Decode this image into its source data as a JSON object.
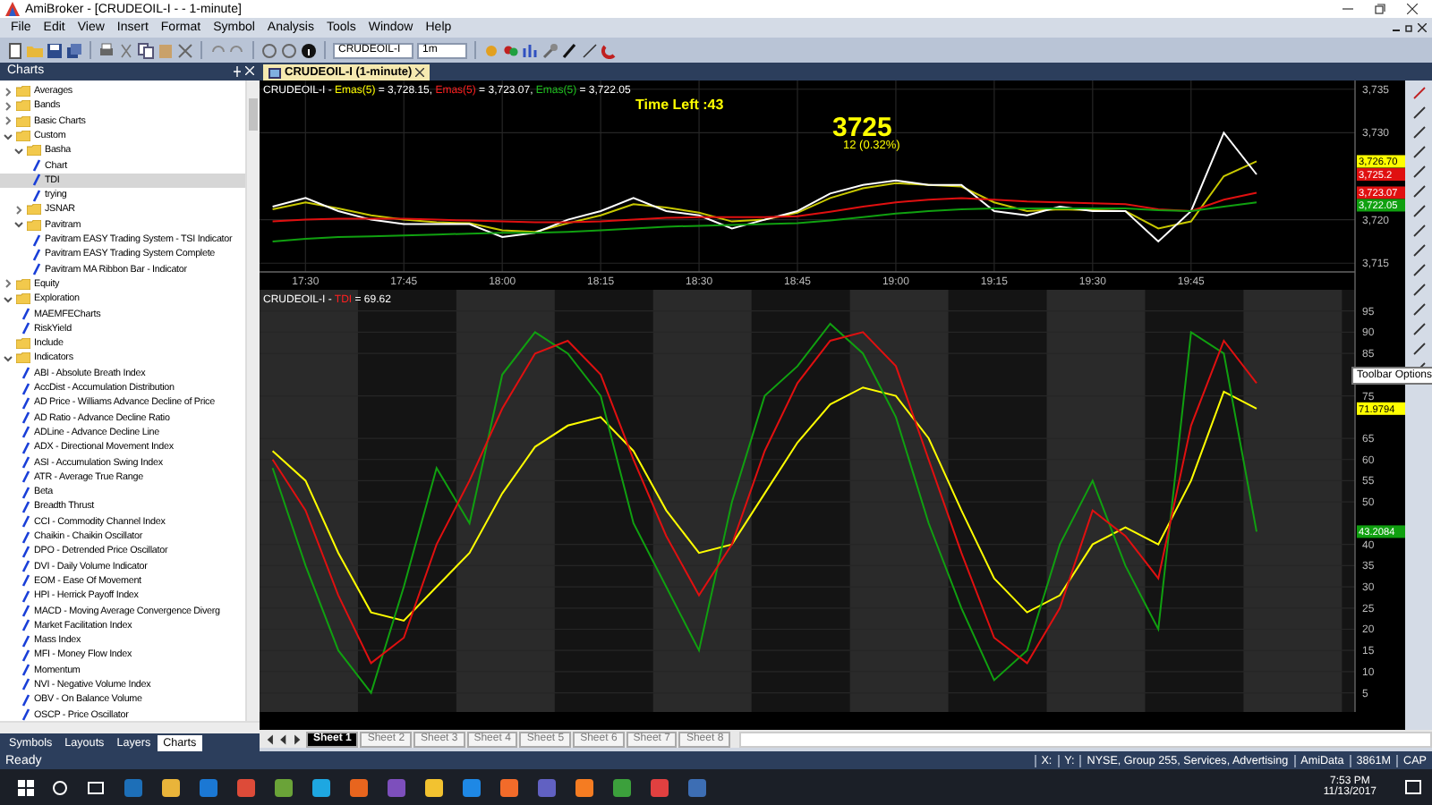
{
  "window": {
    "title": "AmiBroker - [CRUDEOIL-I -  - 1-minute]"
  },
  "menu": [
    "File",
    "Edit",
    "View",
    "Insert",
    "Format",
    "Symbol",
    "Analysis",
    "Tools",
    "Window",
    "Help"
  ],
  "toolbar": {
    "symbol": "CRUDEOIL-I",
    "interval": "1m"
  },
  "charts_panel": {
    "title": "Charts",
    "tree": [
      {
        "label": "Averages",
        "kind": "folder",
        "expanded": false,
        "selected": false
      },
      {
        "label": "Bands",
        "kind": "folder",
        "expanded": false,
        "selected": false
      },
      {
        "label": "Basic Charts",
        "kind": "folder",
        "expanded": false,
        "selected": false
      },
      {
        "label": "Custom",
        "kind": "folder",
        "expanded": true,
        "selected": false,
        "children": [
          {
            "label": "Basha",
            "kind": "folder",
            "expanded": true,
            "selected": false,
            "children": [
              {
                "label": "Chart",
                "kind": "formula",
                "selected": false
              },
              {
                "label": "TDI",
                "kind": "formula",
                "selected": true
              },
              {
                "label": "trying",
                "kind": "formula",
                "selected": false
              }
            ]
          },
          {
            "label": "JSNAR",
            "kind": "folder",
            "expanded": false,
            "selected": false
          },
          {
            "label": "Pavitram",
            "kind": "folder",
            "expanded": true,
            "selected": false,
            "children": [
              {
                "label": "Pavitram EASY Trading System - TSI Indicator",
                "kind": "formula",
                "selected": false
              },
              {
                "label": "Pavitram EASY Trading System Complete",
                "kind": "formula",
                "selected": false
              },
              {
                "label": "Pavitram MA Ribbon Bar - Indicator",
                "kind": "formula",
                "selected": false
              }
            ]
          }
        ]
      },
      {
        "label": "Equity",
        "kind": "folder",
        "expanded": false,
        "selected": false
      },
      {
        "label": "Exploration",
        "kind": "folder",
        "expanded": true,
        "selected": false,
        "children": [
          {
            "label": "MAEMFECharts",
            "kind": "formula",
            "selected": false
          },
          {
            "label": "RiskYield",
            "kind": "formula",
            "selected": false
          }
        ]
      },
      {
        "label": "Include",
        "kind": "folder",
        "selected": false
      },
      {
        "label": "Indicators",
        "kind": "folder",
        "expanded": true,
        "selected": false,
        "children": [
          {
            "label": "ABI - Absolute Breath Index",
            "kind": "formula",
            "selected": false
          },
          {
            "label": "AccDist - Accumulation Distribution",
            "kind": "formula",
            "selected": false
          },
          {
            "label": "AD Price - Williams Advance Decline of Price",
            "kind": "formula",
            "selected": false
          },
          {
            "label": "AD Ratio - Advance Decline Ratio",
            "kind": "formula",
            "selected": false
          },
          {
            "label": "ADLine - Advance Decline Line",
            "kind": "formula",
            "selected": false
          },
          {
            "label": "ADX - Directional Movement Index",
            "kind": "formula",
            "selected": false
          },
          {
            "label": "ASI - Accumulation Swing Index",
            "kind": "formula",
            "selected": false
          },
          {
            "label": "ATR - Average True Range",
            "kind": "formula",
            "selected": false
          },
          {
            "label": "Beta",
            "kind": "formula",
            "selected": false
          },
          {
            "label": "Breadth Thrust",
            "kind": "formula",
            "selected": false
          },
          {
            "label": "CCI - Commodity Channel Index",
            "kind": "formula",
            "selected": false
          },
          {
            "label": "Chaikin - Chaikin Oscillator",
            "kind": "formula",
            "selected": false
          },
          {
            "label": "DPO - Detrended Price Oscillator",
            "kind": "formula",
            "selected": false
          },
          {
            "label": "DVI - Daily Volume Indicator",
            "kind": "formula",
            "selected": false
          },
          {
            "label": "EOM - Ease Of Movement",
            "kind": "formula",
            "selected": false
          },
          {
            "label": "HPI - Herrick Payoff Index",
            "kind": "formula",
            "selected": false
          },
          {
            "label": "MACD - Moving Average Convergence Diverg",
            "kind": "formula",
            "selected": false
          },
          {
            "label": "Market Facilitation Index",
            "kind": "formula",
            "selected": false
          },
          {
            "label": "Mass Index",
            "kind": "formula",
            "selected": false
          },
          {
            "label": "MFI - Money Flow Index",
            "kind": "formula",
            "selected": false
          },
          {
            "label": "Momentum",
            "kind": "formula",
            "selected": false
          },
          {
            "label": "NVI - Negative Volume Index",
            "kind": "formula",
            "selected": false
          },
          {
            "label": "OBV - On Balance Volume",
            "kind": "formula",
            "selected": false
          },
          {
            "label": "OSCP - Price Oscillator",
            "kind": "formula",
            "selected": false
          }
        ]
      }
    ],
    "tabs": [
      {
        "label": "Symbols",
        "selected": false
      },
      {
        "label": "Layouts",
        "selected": false
      },
      {
        "label": "Layers",
        "selected": false
      },
      {
        "label": "Charts",
        "selected": true
      }
    ]
  },
  "document": {
    "tab": "CRUDEOIL-I (1-minute)",
    "price_pane": {
      "legend": [
        {
          "text": "CRUDEOIL-I - ",
          "color": "#ffffff"
        },
        {
          "text": "Emas(5)",
          "color": "#ffff00"
        },
        {
          "text": " = 3,728.15, ",
          "color": "#ffffff"
        },
        {
          "text": "Emas(5)",
          "color": "#ff2020"
        },
        {
          "text": " = 3,723.07, ",
          "color": "#ffffff"
        },
        {
          "text": "Emas(5)",
          "color": "#20c020"
        },
        {
          "text": " = 3,722.05",
          "color": "#ffffff"
        }
      ],
      "time_left": "Time Left :43",
      "last_price": "3725",
      "change": "12 (0.32%)",
      "value_labels": [
        {
          "text": "3,726.70",
          "color": "#ffff00"
        },
        {
          "text": "3,725.2",
          "color": "#e01010"
        },
        {
          "text": "3,723.07",
          "color": "#e01010"
        },
        {
          "text": "3,722.05",
          "color": "#10a010"
        }
      ],
      "chart_data": {
        "type": "line",
        "grid": true,
        "categories": [
          null,
          "17:30",
          null,
          null,
          "17:45",
          null,
          null,
          "18:00",
          null,
          null,
          "18:15",
          null,
          null,
          "18:30",
          null,
          null,
          "18:45",
          null,
          null,
          "19:00",
          null,
          null,
          "19:15",
          null,
          null,
          "19:30",
          null,
          null,
          "19:45",
          null,
          null
        ],
        "ylim": [
          3714,
          3736
        ],
        "yticks": [
          {
            "value": 3715,
            "label": "3,715"
          },
          {
            "value": 3720,
            "label": "3,720"
          },
          {
            "value": 3730,
            "label": "3,730"
          },
          {
            "value": 3735,
            "label": "3,735"
          }
        ],
        "series": [
          {
            "color": "#c8c800",
            "values": [
              3721.2,
              3722,
              3721.3,
              3720.5,
              3720,
              3719.7,
              3719.6,
              3718.8,
              3718.6,
              3719.6,
              3720.5,
              3721.8,
              3721.4,
              3720.8,
              3719.8,
              3720,
              3720.8,
              3722.5,
              3723.6,
              3724.2,
              3724,
              3723.8,
              3722,
              3721,
              3721.2,
              3721.1,
              3721,
              3719,
              3719.8,
              3725,
              3726.7
            ]
          },
          {
            "color": "#ffffff",
            "values": [
              3721.5,
              3722.5,
              3721,
              3720,
              3719.5,
              3719.5,
              3719.5,
              3718,
              3718.5,
              3720,
              3721,
              3722.5,
              3721,
              3720.5,
              3719,
              3720,
              3721,
              3723,
              3724,
              3724.5,
              3724,
              3724,
              3721,
              3720.5,
              3721.5,
              3721,
              3721,
              3717.5,
              3721,
              3730,
              3725.2
            ]
          },
          {
            "color": "#e01010",
            "values": [
              3719.8,
              3720,
              3720.1,
              3720.1,
              3720.1,
              3720,
              3719.9,
              3719.8,
              3719.7,
              3719.7,
              3719.8,
              3720,
              3720.2,
              3720.3,
              3720.3,
              3720.3,
              3720.4,
              3720.9,
              3721.5,
              3722,
              3722.3,
              3722.5,
              3722.3,
              3722.1,
              3722,
              3721.9,
              3721.8,
              3721.2,
              3721,
              3722.3,
              3723.1
            ]
          },
          {
            "color": "#10a010",
            "values": [
              3717.5,
              3717.8,
              3718,
              3718.1,
              3718.2,
              3718.3,
              3718.4,
              3718.5,
              3718.5,
              3718.6,
              3718.8,
              3719,
              3719.2,
              3719.3,
              3719.4,
              3719.5,
              3719.6,
              3719.9,
              3720.3,
              3720.7,
              3721,
              3721.2,
              3721.3,
              3721.3,
              3721.3,
              3721.3,
              3721.3,
              3721.1,
              3721,
              3721.5,
              3722
            ]
          }
        ]
      }
    },
    "tdi_pane": {
      "legend": [
        {
          "text": "CRUDEOIL-I - ",
          "color": "#ffffff"
        },
        {
          "text": "TDI",
          "color": "#ff2020"
        },
        {
          "text": " = 69.62",
          "color": "#ffffff"
        }
      ],
      "value_labels": [
        {
          "text": "71.9794",
          "color": "#ffff00"
        },
        {
          "text": "43.2084",
          "color": "#10a010"
        }
      ],
      "chart_data": {
        "type": "line",
        "grid": true,
        "categories": [
          null,
          null,
          null,
          null,
          null,
          null,
          null,
          null,
          null,
          null,
          null,
          null,
          null,
          null,
          null,
          null,
          null,
          null,
          null,
          null,
          null,
          null,
          null,
          null,
          null,
          null,
          null,
          null,
          null,
          null,
          null
        ],
        "ylim": [
          0.5,
          100
        ],
        "yticks": [
          5,
          10,
          15,
          20,
          25,
          30,
          35,
          40,
          50,
          55,
          60,
          65,
          75,
          85,
          90,
          95
        ],
        "series": [
          {
            "color": "#ffff00",
            "values": [
              62,
              55,
              38,
              24,
              22,
              30,
              38,
              52,
              63,
              68,
              70,
              62,
              48,
              38,
              40,
              52,
              64,
              73,
              77,
              75,
              65,
              48,
              32,
              24,
              28,
              40,
              44,
              40,
              55,
              76,
              72
            ]
          },
          {
            "color": "#10a010",
            "values": [
              58,
              35,
              15,
              5,
              30,
              58,
              45,
              80,
              90,
              85,
              75,
              45,
              30,
              15,
              50,
              75,
              82,
              92,
              85,
              70,
              45,
              25,
              8,
              15,
              40,
              55,
              35,
              20,
              90,
              85,
              43
            ]
          },
          {
            "color": "#e01010",
            "values": [
              60,
              48,
              28,
              12,
              18,
              40,
              55,
              72,
              85,
              88,
              80,
              60,
              42,
              28,
              40,
              62,
              78,
              88,
              90,
              82,
              60,
              38,
              18,
              12,
              25,
              48,
              42,
              32,
              68,
              88,
              78
            ]
          }
        ]
      }
    },
    "tooltip": "Toolbar Options",
    "sheets": [
      {
        "label": "Sheet 1",
        "selected": true
      },
      {
        "label": "Sheet 2",
        "selected": false
      },
      {
        "label": "Sheet 3",
        "selected": false
      },
      {
        "label": "Sheet 4",
        "selected": false
      },
      {
        "label": "Sheet 5",
        "selected": false
      },
      {
        "label": "Sheet 6",
        "selected": false
      },
      {
        "label": "Sheet 7",
        "selected": false
      },
      {
        "label": "Sheet 8",
        "selected": false
      }
    ]
  },
  "status_bar": {
    "message": "Ready",
    "fields": [
      "X:",
      "Y:",
      "NYSE, Group 255, Services, Advertising",
      "AmiData",
      "3861M",
      "CAP"
    ]
  },
  "taskbar": {
    "time": "7:53 PM",
    "date": "11/13/2017"
  }
}
